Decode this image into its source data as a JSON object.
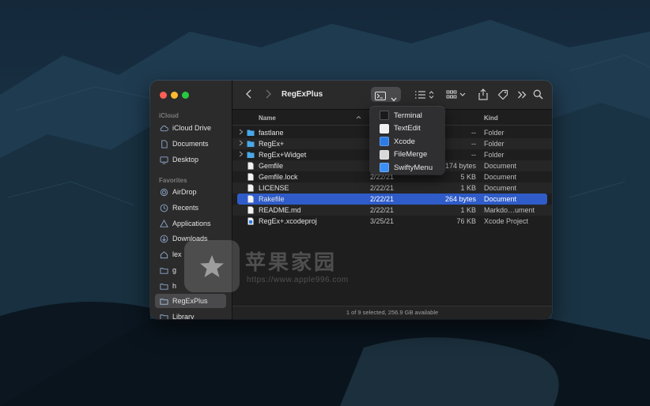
{
  "window": {
    "title": "RegExPlus",
    "status": "1 of 9 selected, 256.9 GB available"
  },
  "sidebar": {
    "sections": [
      {
        "label": "iCloud",
        "items": [
          {
            "label": "iCloud Drive",
            "icon": "cloud-icon"
          },
          {
            "label": "Documents",
            "icon": "document-icon"
          },
          {
            "label": "Desktop",
            "icon": "desktop-icon"
          }
        ]
      },
      {
        "label": "Favorites",
        "items": [
          {
            "label": "AirDrop",
            "icon": "airdrop-icon"
          },
          {
            "label": "Recents",
            "icon": "clock-icon"
          },
          {
            "label": "Applications",
            "icon": "applications-icon"
          },
          {
            "label": "Downloads",
            "icon": "download-icon"
          },
          {
            "label": "lex",
            "icon": "home-icon"
          },
          {
            "label": "g",
            "icon": "folder-icon"
          },
          {
            "label": "h",
            "icon": "folder-icon"
          },
          {
            "label": "RegExPlus",
            "icon": "folder-icon",
            "selected": true
          },
          {
            "label": "Library",
            "icon": "folder-icon"
          }
        ]
      }
    ]
  },
  "columns": {
    "name": "Name",
    "kind": "Kind"
  },
  "files": [
    {
      "name": "fastlane",
      "date": "",
      "size": "--",
      "kind": "Folder",
      "type": "folder"
    },
    {
      "name": "RegEx+",
      "date": "",
      "size": "--",
      "kind": "Folder",
      "type": "folder"
    },
    {
      "name": "RegEx+Widget",
      "date": "",
      "size": "--",
      "kind": "Folder",
      "type": "folder"
    },
    {
      "name": "Gemfile",
      "date": "",
      "size": "174 bytes",
      "kind": "Document",
      "type": "doc"
    },
    {
      "name": "Gemfile.lock",
      "date": "2/22/21",
      "size": "5 KB",
      "kind": "Document",
      "type": "doc"
    },
    {
      "name": "LICENSE",
      "date": "2/22/21",
      "size": "1 KB",
      "kind": "Document",
      "type": "doc"
    },
    {
      "name": "Rakefile",
      "date": "2/22/21",
      "size": "264 bytes",
      "kind": "Document",
      "type": "doc",
      "selected": true
    },
    {
      "name": "README.md",
      "date": "2/22/21",
      "size": "1 KB",
      "kind": "Markdo…ument",
      "type": "doc"
    },
    {
      "name": "RegEx+.xcodeproj",
      "date": "3/25/21",
      "size": "76 KB",
      "kind": "Xcode Project",
      "type": "xcode"
    }
  ],
  "dropdown": {
    "items": [
      {
        "label": "Terminal",
        "color": "#1a1a1a"
      },
      {
        "label": "TextEdit",
        "color": "#f0f0f0"
      },
      {
        "label": "Xcode",
        "color": "#2d7be5"
      },
      {
        "label": "FileMerge",
        "color": "#d8d8d8"
      },
      {
        "label": "SwiftyMenu",
        "color": "#3b8ff5"
      }
    ]
  },
  "watermark": {
    "text": "苹果家园",
    "url": "https://www.apple996.com"
  },
  "colors": {
    "accent": "#2f5cc9",
    "folder": "#4aa8e8",
    "close": "#ff5f57",
    "minimize": "#febc2e",
    "zoom": "#28c840"
  }
}
